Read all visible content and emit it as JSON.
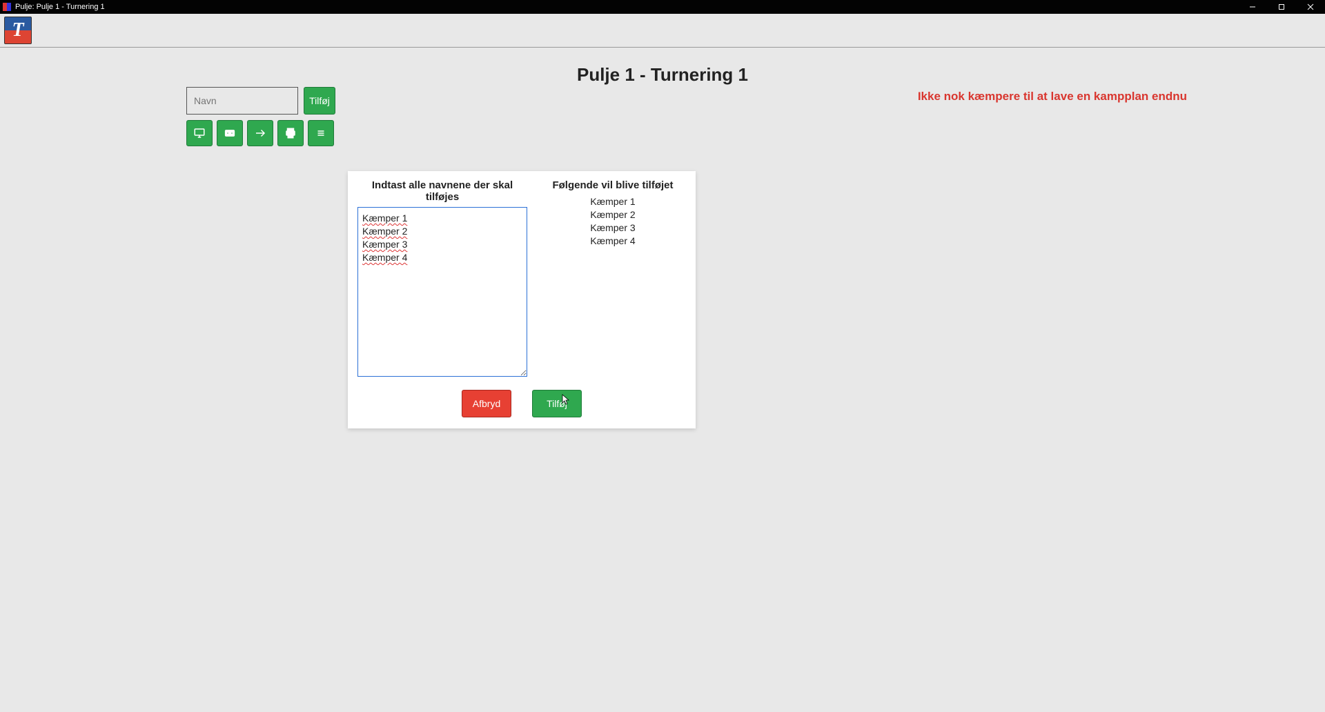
{
  "window": {
    "title": "Pulje: Pulje 1 - Turnering 1"
  },
  "page": {
    "title": "Pulje 1 - Turnering 1",
    "warning": "Ikke nok kæmpere til at lave en kampplan endnu"
  },
  "controls": {
    "name_placeholder": "Navn",
    "add_label": "Tilføj"
  },
  "dialog": {
    "input_heading": "Indtast alle navnene der skal tilføjes",
    "preview_heading": "Følgende vil blive tilføjet",
    "textarea_value": "Kæmper 1\nKæmper 2\nKæmper 3\nKæmper 4",
    "preview_items": [
      "Kæmper 1",
      "Kæmper 2",
      "Kæmper 3",
      "Kæmper 4"
    ],
    "cancel_label": "Afbryd",
    "confirm_label": "Tilføj"
  },
  "icons": {
    "display": "display-icon",
    "card": "card-icon",
    "shuffle": "shuffle-icon",
    "print": "print-icon",
    "list": "list-icon"
  }
}
